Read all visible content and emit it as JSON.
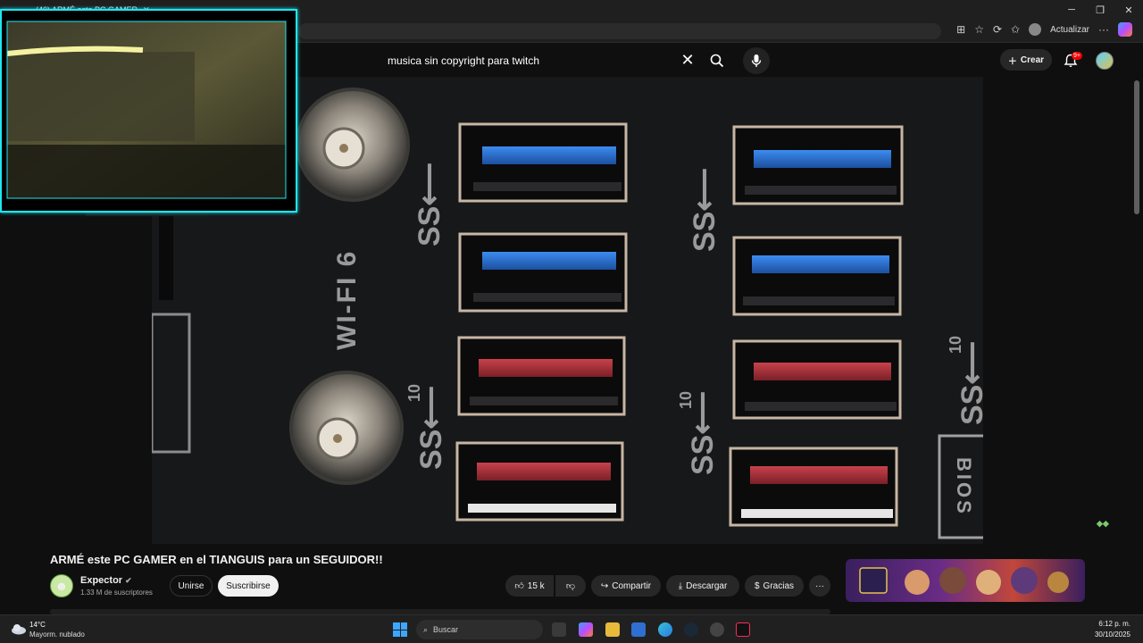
{
  "browser": {
    "tab_title": "(40) ARMÉ este PC GAMER",
    "update_label": "Actualizar"
  },
  "header": {
    "search_value": "musica sin copyright para twitch",
    "create_label": "Crear",
    "notifications_badge": "9+"
  },
  "video": {
    "title": "ARMÉ este PC GAMER en el TIANGUIS para un SEGUIDOR!!",
    "wifi_label": "WI-FI 6",
    "bios_label": "BIOS",
    "usb_speed_labels": [
      "10",
      "10",
      "10"
    ]
  },
  "channel": {
    "name": "Expector",
    "subscribers": "1.33 M de suscriptores",
    "join_label": "Unirse",
    "subscribe_label": "Suscribirse"
  },
  "actions": {
    "likes": "15 k",
    "share_label": "Compartir",
    "download_label": "Descargar",
    "thanks_label": "Gracias"
  },
  "taskbar": {
    "temperature": "14°C",
    "weather": "Mayorm. nublado",
    "search_placeholder": "Buscar",
    "time": "6:12 p. m.",
    "date": "30/10/2025"
  },
  "colors": {
    "webcam_border": "#1ee6f0",
    "usb3_blue": "#2a6fd6",
    "usb_red": "#b8323c",
    "brand_accent": "#3ea6ff"
  }
}
